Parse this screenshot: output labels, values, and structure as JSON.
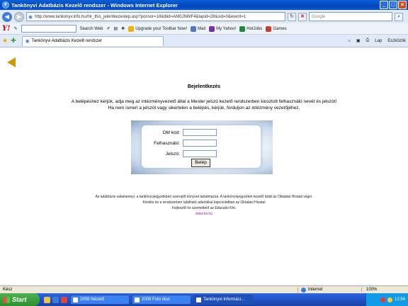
{
  "window": {
    "title": "Tankönyvi Adatbázis Kezelő rendszer - Windows Internet Explorer",
    "ie_icon": "ie-icon",
    "min": "_",
    "max": "□",
    "close": "×"
  },
  "address": {
    "back": "◀",
    "forward": "▶",
    "url": "http://www.tankonyv.info.hu/hir_this_jelentkezeslep.asp?ponsor=18&lbid=AM0JNWF4&lapid=28&sid=0&event=1",
    "refresh": "↻",
    "stop": "✕",
    "search_placeholder": "Google"
  },
  "yahoo_toolbar": {
    "logo": "Y!",
    "search_web": "Search Web",
    "upgrade": "Upgrade your Toolbar Now!",
    "mail": "Mail",
    "my_yahoo": "My Yahoo!",
    "hotjobs": "HotJobs",
    "games": "Games"
  },
  "tabs": {
    "active_label": "Tankönyvi Adatbázis Kezelő rendszer",
    "home": "⌂",
    "print": "⎙",
    "page": "Lap",
    "tools": "Eszközök"
  },
  "page": {
    "heading": "Bejelentkezés",
    "instruction_1": "A belépéshez kérjük, adja meg az intézményvezető által a Mester jelszó kezelő rendszerben kiosztott felhasználó nevét és jelszót!",
    "instruction_2": "Ha nem ismeri a jelszót vagy sikertelen a belépés, kérjük, forduljon az intézmény vezetőjéhez.",
    "form": {
      "om_label": "OM kód:",
      "user_label": "Felhasználó:",
      "password_label": "Jelszó:",
      "login_button": "Belép"
    },
    "footer": {
      "line_1": "Az adatbázis valamennyi, a tankönyvjegyzékben szereplő könyvet tartalmazza. A tankönyvjegyzéket kezelő listát az Oktatási Hivatal végzi.",
      "line_2": "Kérdés és a rendszerben található adatokkal kapcsolatban az Oktatási Hivatal",
      "line_3": "Fejlesztő és üzemeltető az Educatio Kht.",
      "link": "www.kir.hu"
    }
  },
  "status": {
    "text": "Kész",
    "zone": "Internet",
    "zoom": "100%"
  },
  "taskbar": {
    "start": "Start",
    "tasks": [
      "2008 Nézető",
      "2008 Foto rész",
      "Tankönyvi Informáci..."
    ],
    "clock": "12:54"
  },
  "colors": {
    "titlebar": "#0348b8",
    "link": "#a020a0",
    "back_arrow": "#c89a10"
  }
}
